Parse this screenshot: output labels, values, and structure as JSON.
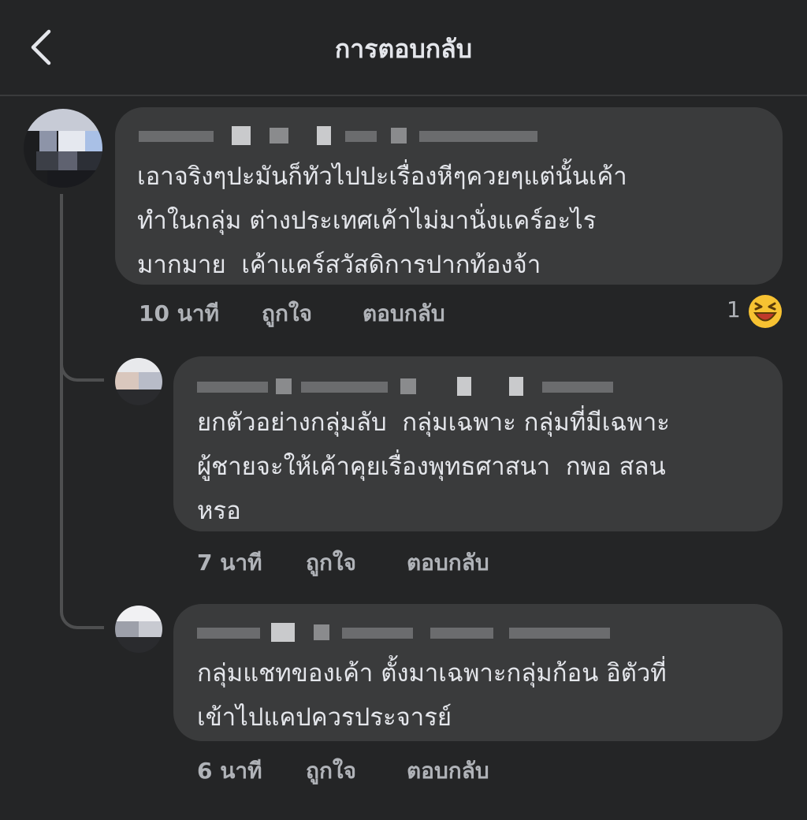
{
  "header": {
    "title": "การตอบกลับ",
    "back_icon": "chevron-left-icon"
  },
  "comments": [
    {
      "text": "เอาจริงๆปะมันก็ทัวไปปะเรื่องหีๆควยๆแต่นั้นเค้า\nทำในกลุ่ม ต่างประเทศเค้าไม่มานั่งแคร์อะไร\nมากมาย  เค้าแคร์สวัสดิการปากท้องจ้า",
      "time": "10 นาที",
      "like_label": "ถูกใจ",
      "reply_label": "ตอบกลับ",
      "reaction_count": "1",
      "reaction_icon": "laughing-emoji-icon"
    },
    {
      "text": "ยกตัวอย่างกลุ่มลับ  กลุ่มเฉพาะ กลุ่มที่มีเฉพาะ\nผู้ชายจะให้เค้าคุยเรื่องพุทธศาสนา  กพอ สลน\nหรอ",
      "time": "7 นาที",
      "like_label": "ถูกใจ",
      "reply_label": "ตอบกลับ"
    },
    {
      "text": "กลุ่มแชทของเค้า ตั้งมาเฉพาะกลุ่มก้อน อิตัวที่\nเข้าไปแคปควรประจารย์",
      "time": "6 นาที",
      "like_label": "ถูกใจ",
      "reply_label": "ตอบกลับ"
    }
  ],
  "colors": {
    "background": "#242526",
    "bubble": "#3a3b3c",
    "text": "#e4e6eb",
    "meta": "#b0b3b8",
    "thread_line": "#4e4f50",
    "emoji_face": "#f7c232",
    "emoji_mouth": "#c0392b"
  }
}
